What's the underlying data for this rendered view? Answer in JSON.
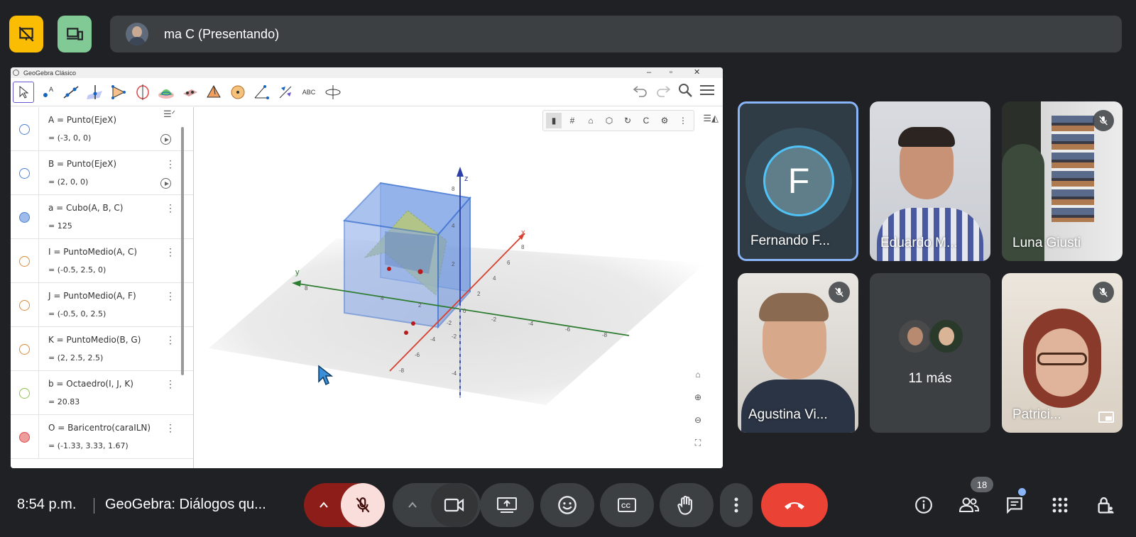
{
  "presenter": {
    "name": "ma C (Presentando)"
  },
  "geogebra": {
    "window_title": "GeoGebra Clásico",
    "tool_text": "ABC",
    "algebra": [
      {
        "def": "A = Punto(EjeX)",
        "val": "= (-3, 0, 0)",
        "color": "#4a7fd6",
        "filled": false
      },
      {
        "def": "B = Punto(EjeX)",
        "val": "= (2, 0, 0)",
        "color": "#4a7fd6",
        "filled": false
      },
      {
        "def": "a = Cubo(A, B, C)",
        "val": "= 125",
        "color": "#4a7fd6",
        "filled": true
      },
      {
        "def": "I = PuntoMedio(A, C)",
        "val": "= (-0.5, 2.5, 0)",
        "color": "#d88a3a",
        "filled": false
      },
      {
        "def": "J = PuntoMedio(A, F)",
        "val": "= (-0.5, 0, 2.5)",
        "color": "#d88a3a",
        "filled": false
      },
      {
        "def": "K = PuntoMedio(B, G)",
        "val": "= (2, 2.5, 2.5)",
        "color": "#d88a3a",
        "filled": false
      },
      {
        "def": "b = Octaedro(I, J, K)",
        "val": "= 20.83",
        "color": "#8bc34a",
        "filled": false
      },
      {
        "def": "O = Baricentro(caraILN)",
        "val": "= (-1.33, 3.33, 1.67)",
        "color": "#e04848",
        "filled": true
      }
    ],
    "axes": {
      "x": "x",
      "y": "y",
      "z": "z"
    }
  },
  "tiles": [
    {
      "name": "Fernando F...",
      "initial": "F",
      "muted": false
    },
    {
      "name": "Eduardo M...",
      "muted": false
    },
    {
      "name": "Luna Giusti",
      "muted": true
    },
    {
      "name": "Agustina Vi...",
      "muted": true
    },
    {
      "name": "11 más",
      "muted": false
    },
    {
      "name": "Patrici...",
      "muted": true
    }
  ],
  "bottom": {
    "time": "8:54 p.m.",
    "meeting_title": "GeoGebra: Diálogos qu...",
    "participants_count": "18"
  },
  "colors": {
    "accent_yellow": "#fbbc04",
    "accent_green": "#81c995",
    "end_call": "#ea4335",
    "mic_off_bg": "#f9dedc",
    "mic_group": "#8c1d18"
  }
}
